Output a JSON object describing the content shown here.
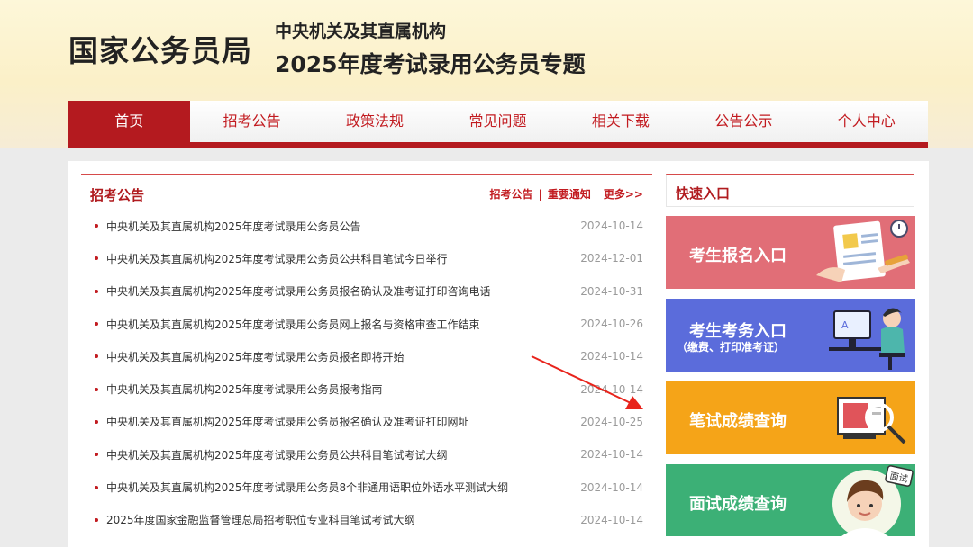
{
  "header": {
    "logo": "国家公务员局",
    "subtitle_line1": "中央机关及其直属机构",
    "subtitle_line2": "2025年度考试录用公务员专题"
  },
  "nav": {
    "items": [
      {
        "label": "首页",
        "active": true
      },
      {
        "label": "招考公告"
      },
      {
        "label": "政策法规"
      },
      {
        "label": "常见问题"
      },
      {
        "label": "相关下载"
      },
      {
        "label": "公告公示"
      },
      {
        "label": "个人中心"
      }
    ]
  },
  "notice_panel": {
    "title": "招考公告",
    "links": [
      "招考公告",
      "重要通知"
    ],
    "more": "更多>>",
    "items": [
      {
        "title": "中央机关及其直属机构2025年度考试录用公务员公告",
        "date": "2024-10-14"
      },
      {
        "title": "中央机关及其直属机构2025年度考试录用公务员公共科目笔试今日举行",
        "date": "2024-12-01"
      },
      {
        "title": "中央机关及其直属机构2025年度考试录用公务员报名确认及准考证打印咨询电话",
        "date": "2024-10-31"
      },
      {
        "title": "中央机关及其直属机构2025年度考试录用公务员网上报名与资格审查工作结束",
        "date": "2024-10-26"
      },
      {
        "title": "中央机关及其直属机构2025年度考试录用公务员报名即将开始",
        "date": "2024-10-14"
      },
      {
        "title": "中央机关及其直属机构2025年度考试录用公务员报考指南",
        "date": "2024-10-14"
      },
      {
        "title": "中央机关及其直属机构2025年度考试录用公务员报名确认及准考证打印网址",
        "date": "2024-10-25"
      },
      {
        "title": "中央机关及其直属机构2025年度考试录用公务员公共科目笔试考试大纲",
        "date": "2024-10-14"
      },
      {
        "title": "中央机关及其直属机构2025年度考试录用公务员8个非通用语职位外语水平测试大纲",
        "date": "2024-10-14"
      },
      {
        "title": "2025年度国家金融监督管理总局招考职位专业科目笔试考试大纲",
        "date": "2024-10-14"
      }
    ]
  },
  "quick_entry": {
    "title": "快速入口",
    "cards": [
      {
        "label": "考生报名入口",
        "color": "#e16e77",
        "icon": "registration-form-icon"
      },
      {
        "label": "考生考务入口",
        "sub": "（缴费、打印准考证）",
        "color": "#5b6cdb",
        "icon": "computer-user-icon"
      },
      {
        "label": "笔试成绩查询",
        "color": "#f5a418",
        "icon": "exam-paper-icon"
      },
      {
        "label": "面试成绩查询",
        "color": "#3cb076",
        "icon": "interview-avatar-icon",
        "badge": "面试"
      }
    ]
  },
  "annotation": {
    "color": "#e8241c",
    "icon": "red-arrow-icon"
  }
}
